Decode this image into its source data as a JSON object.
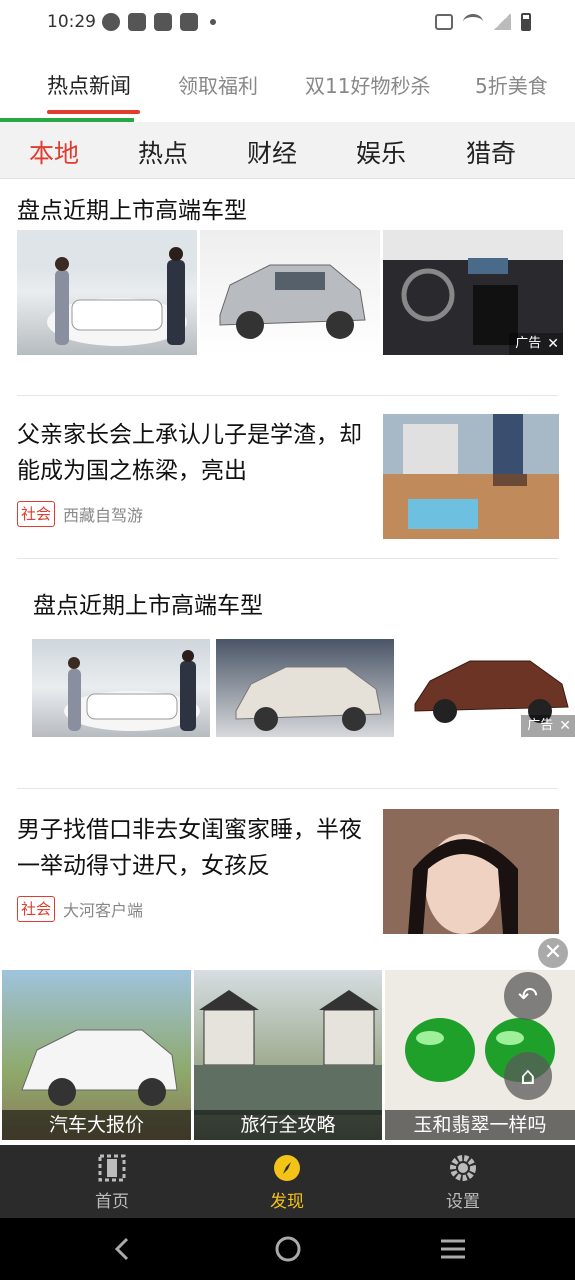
{
  "status_bar": {
    "time": "10:29"
  },
  "top_tabs": [
    {
      "label": "热点新闻",
      "active": true
    },
    {
      "label": "领取福利",
      "active": false
    },
    {
      "label": "双11好物秒杀",
      "active": false
    },
    {
      "label": "5折美食",
      "active": false
    }
  ],
  "category_tabs": [
    {
      "label": "本地",
      "active": true
    },
    {
      "label": "热点",
      "active": false
    },
    {
      "label": "财经",
      "active": false
    },
    {
      "label": "娱乐",
      "active": false
    },
    {
      "label": "猎奇",
      "active": false
    }
  ],
  "feed": {
    "item1": {
      "title": "盘点近期上市高端车型",
      "ad_label": "广告"
    },
    "item2": {
      "title": "父亲家长会上承认儿子是学渣，却能成为国之栋梁，亮出",
      "tag": "社会",
      "source": "西藏自驾游"
    },
    "item3": {
      "title": "盘点近期上市高端车型",
      "ad_label": "广告"
    },
    "item4": {
      "title": "男子找借口非去女闺蜜家睡，半夜一举动得寸进尺，女孩反",
      "tag": "社会",
      "source": "大河客户端"
    }
  },
  "banner": {
    "items": [
      {
        "label": "汽车大报价"
      },
      {
        "label": "旅行全攻略"
      },
      {
        "label": "玉和翡翠一样吗"
      }
    ]
  },
  "bottom_nav": [
    {
      "label": "首页",
      "icon": "home-frame-icon",
      "active": false
    },
    {
      "label": "发现",
      "icon": "compass-icon",
      "active": true
    },
    {
      "label": "设置",
      "icon": "gear-icon",
      "active": false
    }
  ],
  "colors": {
    "accent_red": "#e03c2f",
    "accent_yellow": "#f3c318",
    "green": "#27a745"
  }
}
